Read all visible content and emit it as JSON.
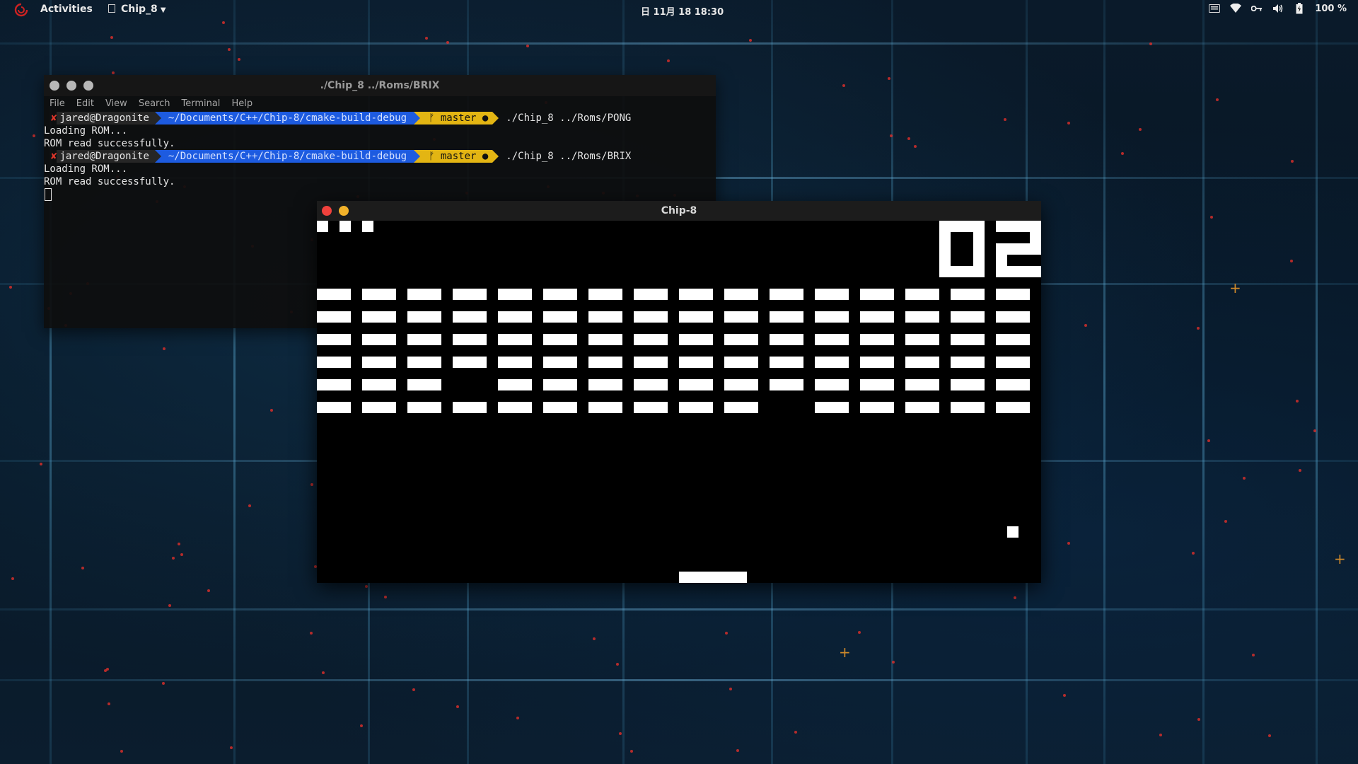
{
  "topbar": {
    "activities": "Activities",
    "app_menu": "Chip_8",
    "clock": "日 11月 18  18:30",
    "battery": "100 %"
  },
  "terminal": {
    "title": "./Chip_8 ../Roms/BRIX",
    "menu": [
      "File",
      "Edit",
      "View",
      "Search",
      "Terminal",
      "Help"
    ],
    "prompts": [
      {
        "status": "✘",
        "user": "jared@Dragonite",
        "path": "~/Documents/C++/Chip-8/cmake-build-debug",
        "branch": "ᚠ master ●",
        "command": "./Chip_8 ../Roms/PONG"
      },
      {
        "status": "✘",
        "user": "jared@Dragonite",
        "path": "~/Documents/C++/Chip-8/cmake-build-debug",
        "branch": "ᚠ master ●",
        "command": "./Chip_8 ../Roms/BRIX"
      }
    ],
    "output": [
      "Loading ROM...",
      "ROM read successfully."
    ]
  },
  "chip8": {
    "title": "Chip-8",
    "lives": 3,
    "score": "02",
    "missing_bricks": [
      [
        4,
        3
      ],
      [
        5,
        10
      ],
      [
        5,
        10
      ]
    ],
    "colors": {
      "close": "#f0413c",
      "minimize": "#f2b22a"
    }
  }
}
